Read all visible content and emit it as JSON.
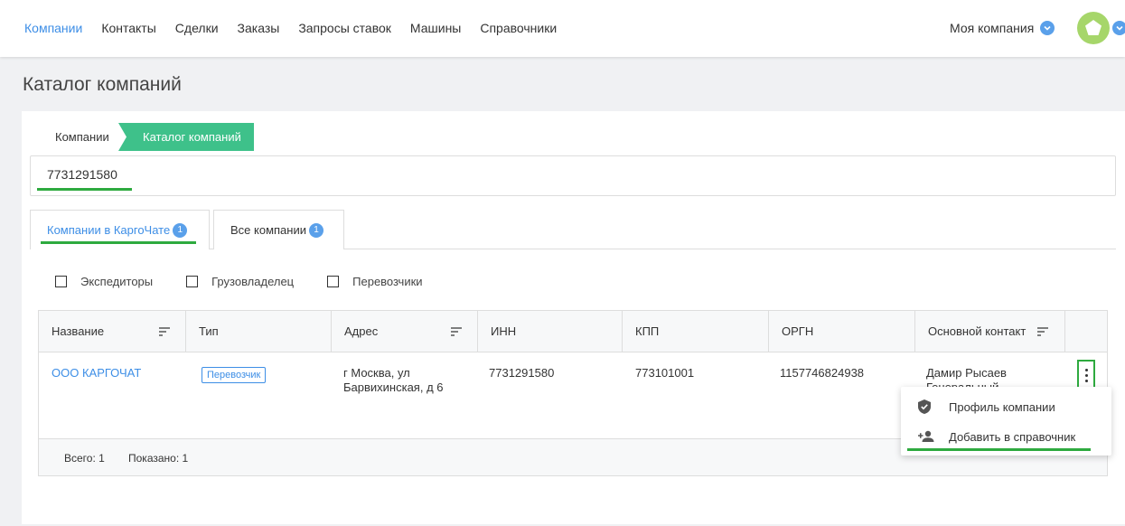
{
  "nav": {
    "items": [
      "Компании",
      "Контакты",
      "Сделки",
      "Заказы",
      "Запросы ставок",
      "Машины",
      "Справочники"
    ],
    "active_index": 0,
    "company_selector": "Моя компания"
  },
  "page": {
    "title": "Каталог компаний"
  },
  "breadcrumb": {
    "root": "Компании",
    "current": "Каталог компаний"
  },
  "search": {
    "value": "7731291580"
  },
  "tabs": [
    {
      "label": "Компании в КаргоЧате",
      "count": "1"
    },
    {
      "label": "Все компании",
      "count": "1"
    }
  ],
  "filters": [
    "Экспедиторы",
    "Грузовладелец",
    "Перевозчики"
  ],
  "table": {
    "headers": [
      "Название",
      "Тип",
      "Адрес",
      "ИНН",
      "КПП",
      "ОРГН",
      "Основной контакт"
    ],
    "row": {
      "name": "ООО КАРГОЧАТ",
      "type": "Перевозчик",
      "address_line1": "г Москва, ул",
      "address_line2": "Барвихинская, д 6",
      "inn": "7731291580",
      "kpp": "773101001",
      "ogrn": "1157746824938",
      "contact_line1": "Дамир Рысаев",
      "contact_line2": "Генеральный"
    },
    "footer": {
      "total": "Всего: 1",
      "shown": "Показано: 1"
    }
  },
  "context_menu": {
    "items": [
      "Профиль компании",
      "Добавить в справочник"
    ]
  },
  "colors": {
    "accent": "#3d8ee6",
    "active_green": "#3ec18a",
    "highlight": "#2eaa3f"
  }
}
